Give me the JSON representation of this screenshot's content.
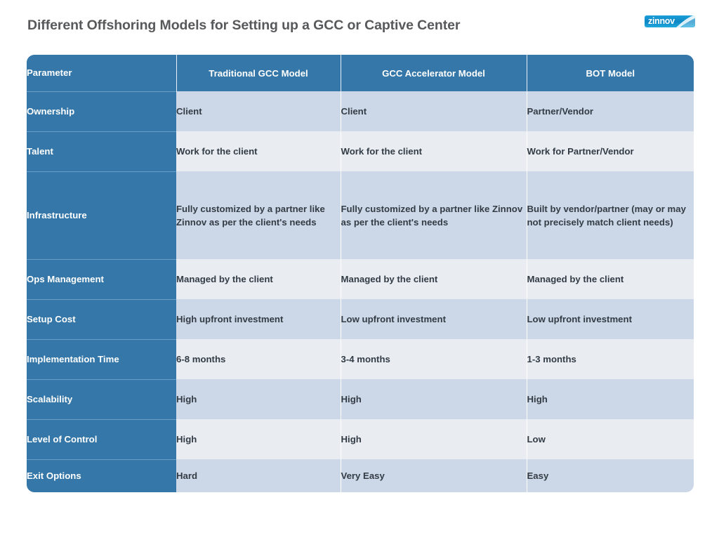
{
  "page": {
    "title": "Different Offshoring Models for Setting up a GCC or Captive Center",
    "background_color": "#ffffff"
  },
  "brand": {
    "logo_text": "zinnov",
    "logo_color": "#0d86c4",
    "icon": "swoosh-icon"
  },
  "theme": {
    "header_blue": "#3477a8",
    "param_column_blue": "#3477a8",
    "band_dark": "#ccd8e7",
    "band_light": "#e9edf2",
    "title_color": "#58595b",
    "value_text_color": "#333b45"
  },
  "table": {
    "columns": [
      "Parameter",
      "Traditional GCC Model",
      "GCC Accelerator Model",
      "BOT Model"
    ],
    "rows": [
      {
        "parameter": "Ownership",
        "traditional": "Client",
        "accelerator": "Client",
        "bot": "Partner/Vendor",
        "band": "dark",
        "height": "std"
      },
      {
        "parameter": "Talent",
        "traditional": "Work for the client",
        "accelerator": "Work for the client",
        "bot": "Work for Partner/Vendor",
        "band": "light",
        "height": "std"
      },
      {
        "parameter": "Infrastructure",
        "traditional": "Fully customized by a partner like Zinnov as per the client's needs",
        "accelerator": "Fully customized by a partner like Zinnov as per the client's needs",
        "bot": "Built by vendor/partner (may or may not precisely match client needs)",
        "band": "dark",
        "height": "tall"
      },
      {
        "parameter": "Ops Management",
        "traditional": "Managed by the client",
        "accelerator": "Managed by the client",
        "bot": "Managed by the client",
        "band": "light",
        "height": "std"
      },
      {
        "parameter": "Setup Cost",
        "traditional": "High upfront investment",
        "accelerator": "Low upfront investment",
        "bot": "Low upfront investment",
        "band": "dark",
        "height": "std"
      },
      {
        "parameter": "Implementation Time",
        "traditional": "6-8 months",
        "accelerator": "3-4 months",
        "bot": "1-3 months",
        "band": "light",
        "height": "std"
      },
      {
        "parameter": "Scalability",
        "traditional": "High",
        "accelerator": "High",
        "bot": "High",
        "band": "dark",
        "height": "std"
      },
      {
        "parameter": "Level of Control",
        "traditional": "High",
        "accelerator": "High",
        "bot": "Low",
        "band": "light",
        "height": "std"
      },
      {
        "parameter": "Exit Options",
        "traditional": "Hard",
        "accelerator": "Very Easy",
        "bot": "Easy",
        "band": "dark",
        "height": "short"
      }
    ]
  }
}
